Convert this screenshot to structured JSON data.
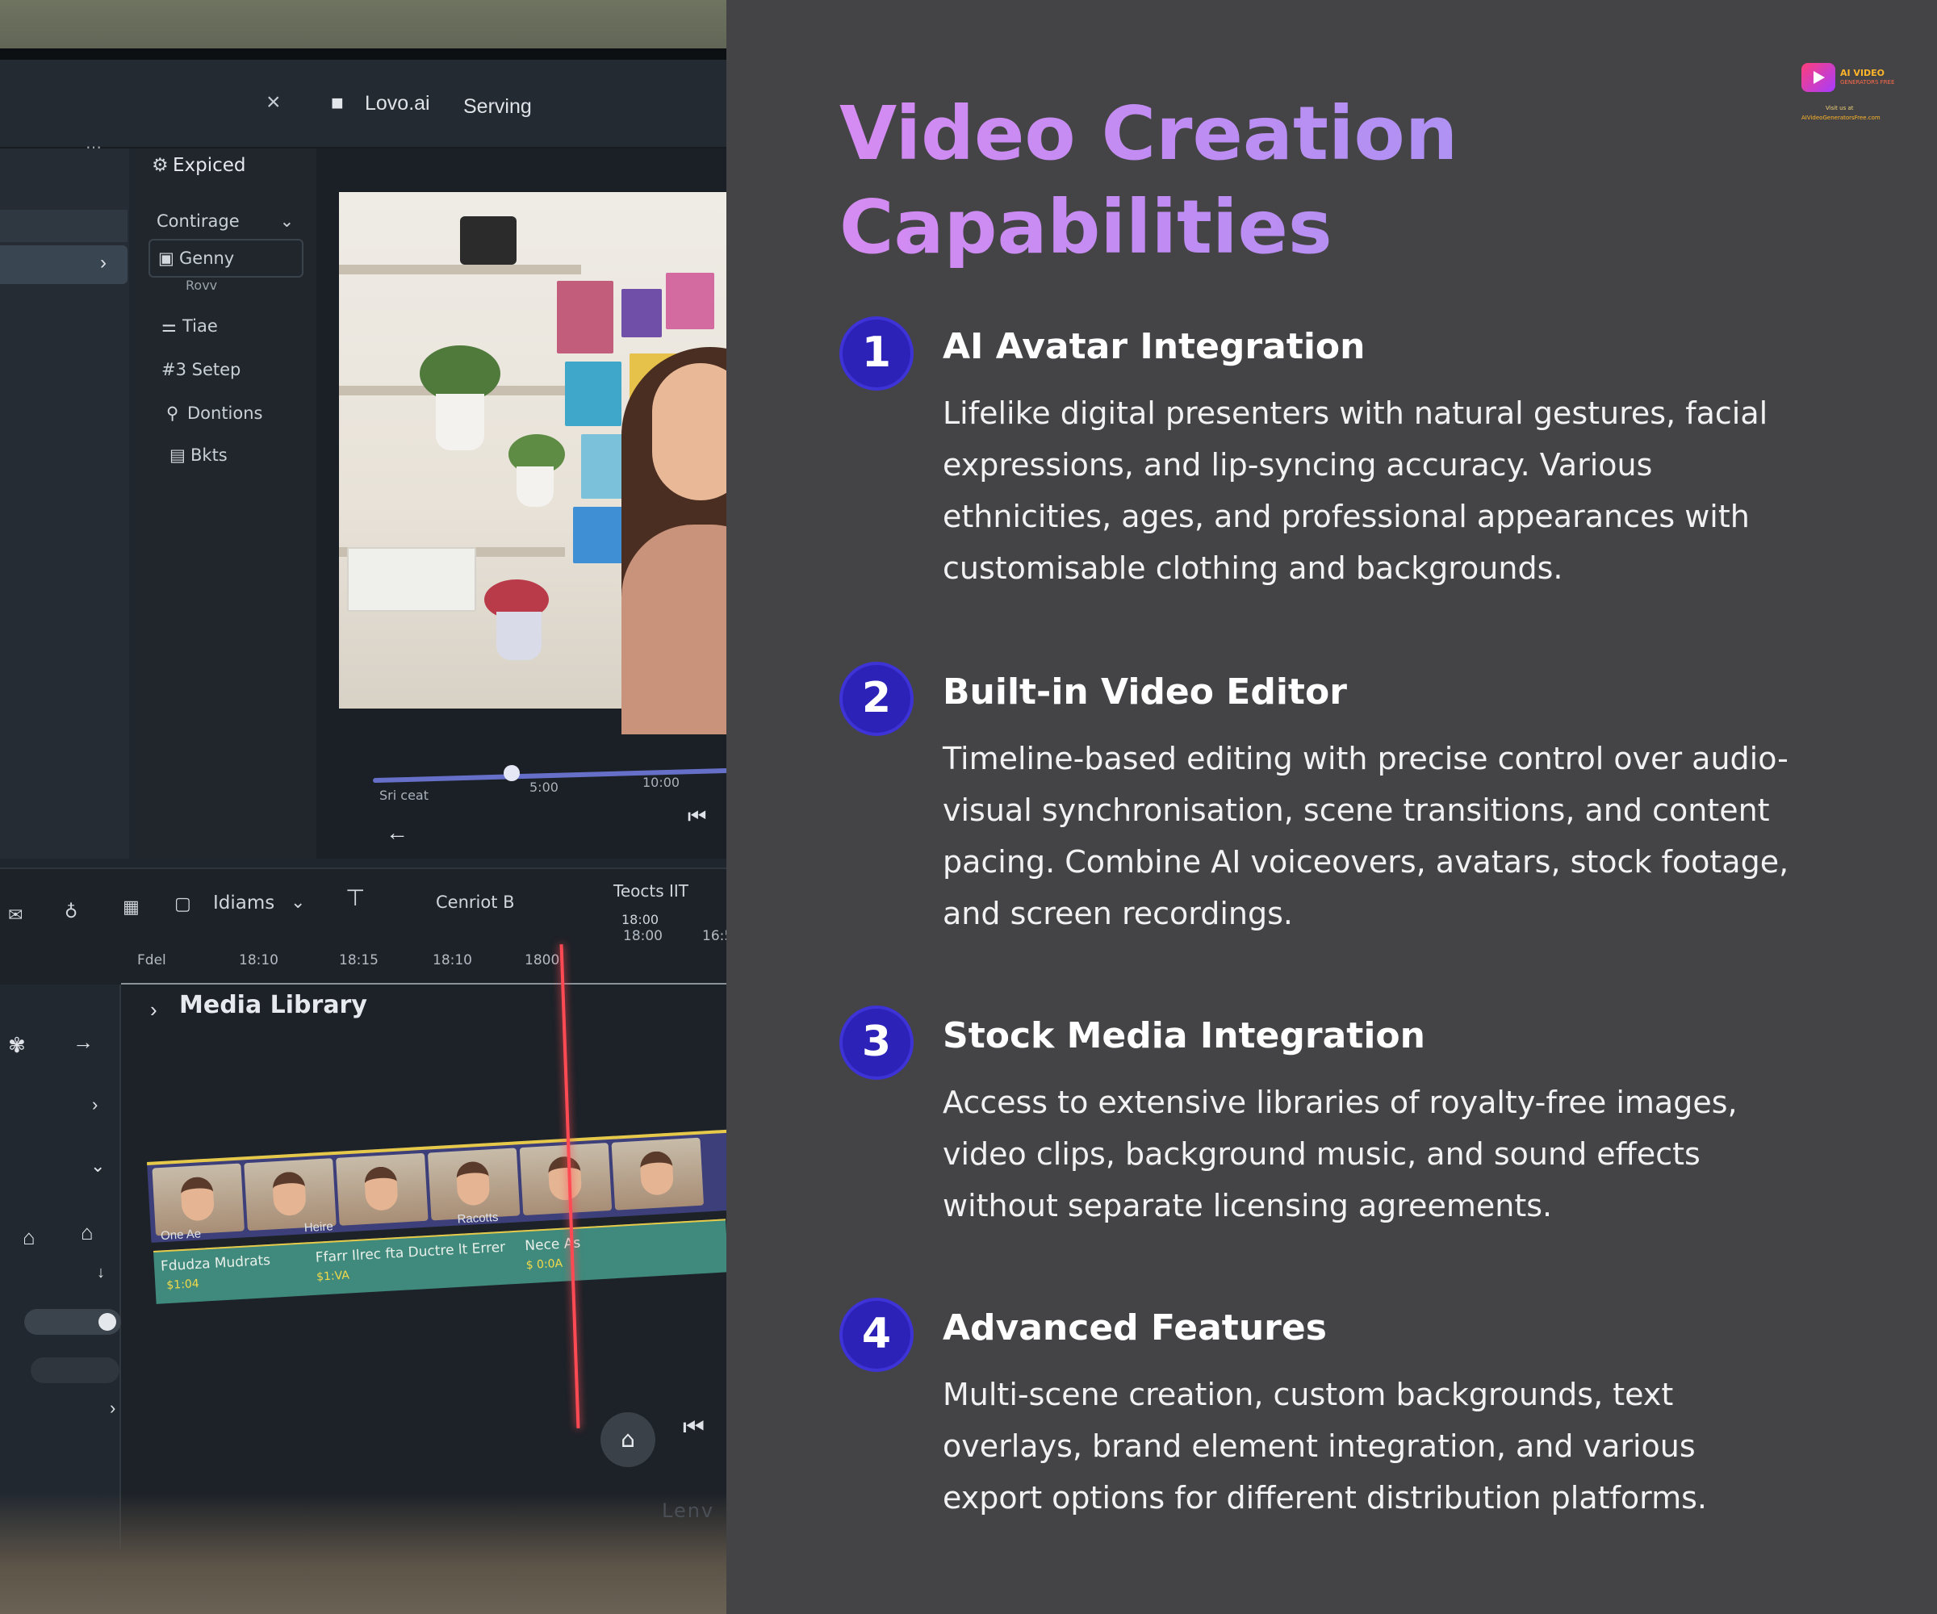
{
  "screen": {
    "close_glyph": "×",
    "app_name": "Lovo.ai",
    "app_section": "Serving",
    "menu": {
      "header": "Expiced",
      "items": [
        {
          "icon": "settings-icon",
          "label": "Contirage"
        },
        {
          "icon": "square-icon",
          "label": "Genny"
        },
        {
          "icon": "",
          "label": "Rovv"
        },
        {
          "icon": "text-icon",
          "label": "Tiae"
        },
        {
          "icon": "hash-icon",
          "label": "#3 Setep"
        },
        {
          "icon": "tag-icon",
          "label": "Dontions"
        },
        {
          "icon": "book-icon",
          "label": "Bkts"
        }
      ]
    },
    "scrubber": {
      "labels": [
        "Sri ceat",
        "5:00",
        "10:00"
      ],
      "progress": 0.25
    },
    "timeline": {
      "toolbar": {
        "tab_label": "Idiams",
        "center_label": "Cenriot B",
        "right_label": "Teocts IIT",
        "right_sub": "18:00"
      },
      "ruler": [
        "Fdel",
        "18:10",
        "18:15",
        "18:10",
        "1800",
        "18:00",
        "16:5"
      ],
      "media_library": "Media Library",
      "clip_labels": [
        "One Ae",
        "Heire",
        "Racotts"
      ],
      "audio_labels": [
        "Fdudza Mudrats",
        "Ffarr Ilrec fta Ductre lt Errer",
        "Nece As"
      ],
      "audio_sub": [
        "$1:04",
        "$1:VA",
        "$ 0:0A"
      ]
    },
    "brand_watermark": "Lenv"
  },
  "panel": {
    "title": "Video Creation Capabilities",
    "logo": {
      "name": "AI VIDEO",
      "sub": "GENERATORS FREE",
      "visit": "Visit us at",
      "url": "AIVideoGeneratorsFree.com"
    },
    "features": [
      {
        "num": "1",
        "title": "AI Avatar Integration",
        "desc": "Lifelike digital presenters with natural gestures, facial expressions, and lip-syncing accuracy. Various ethnicities, ages, and professional appearances with customisable clothing and backgrounds."
      },
      {
        "num": "2",
        "title": "Built-in Video Editor",
        "desc": "Timeline-based editing with precise control over audio-visual synchronisation, scene transitions, and content pacing. Combine AI voiceovers, avatars, stock footage, and screen recordings."
      },
      {
        "num": "3",
        "title": "Stock Media Integration",
        "desc": "Access to extensive libraries of royalty-free images, video clips, background music, and sound effects without separate licensing agreements."
      },
      {
        "num": "4",
        "title": "Advanced Features",
        "desc": "Multi-scene creation, custom backgrounds, text overlays, brand element integration, and various export options for different distribution platforms."
      }
    ],
    "colors": {
      "badge": "#2c22b8",
      "title_gradient_start": "#d58bf2",
      "title_gradient_end": "#a894f3",
      "background": "#444446"
    }
  }
}
